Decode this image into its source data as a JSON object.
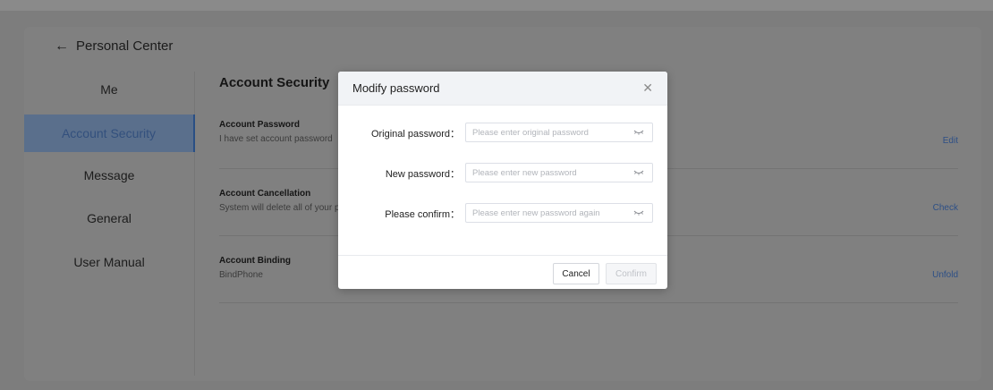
{
  "header": {
    "back_label": "Personal Center"
  },
  "sidebar": {
    "items": [
      {
        "label": "Me"
      },
      {
        "label": "Account Security"
      },
      {
        "label": "Message"
      },
      {
        "label": "General"
      },
      {
        "label": "User Manual"
      }
    ],
    "active_index": 1
  },
  "main": {
    "section_title": "Account Security",
    "rows": [
      {
        "title": "Account Password",
        "desc": "I have set account password",
        "action": "Edit"
      },
      {
        "title": "Account Cancellation",
        "desc": "System will delete all of your p",
        "action": "Check"
      },
      {
        "title": "Account Binding",
        "desc": "BindPhone",
        "action": "Unfold"
      }
    ]
  },
  "modal": {
    "title": "Modify password",
    "fields": [
      {
        "label": "Original password：",
        "placeholder": "Please enter original password",
        "value": ""
      },
      {
        "label": "New password：",
        "placeholder": "Please enter new password",
        "value": ""
      },
      {
        "label": "Please confirm：",
        "placeholder": "Please enter new password again",
        "value": ""
      }
    ],
    "cancel_label": "Cancel",
    "confirm_label": "Confirm"
  },
  "colors": {
    "overlay_bg": "#7d7d7d",
    "active_item_bg": "#5a6f8c",
    "link_color": "#2d4f86",
    "modal_header_bg": "#f1f3f6"
  },
  "icons": [
    "arrow-left-icon",
    "close-icon",
    "eye-closed-icon"
  ]
}
